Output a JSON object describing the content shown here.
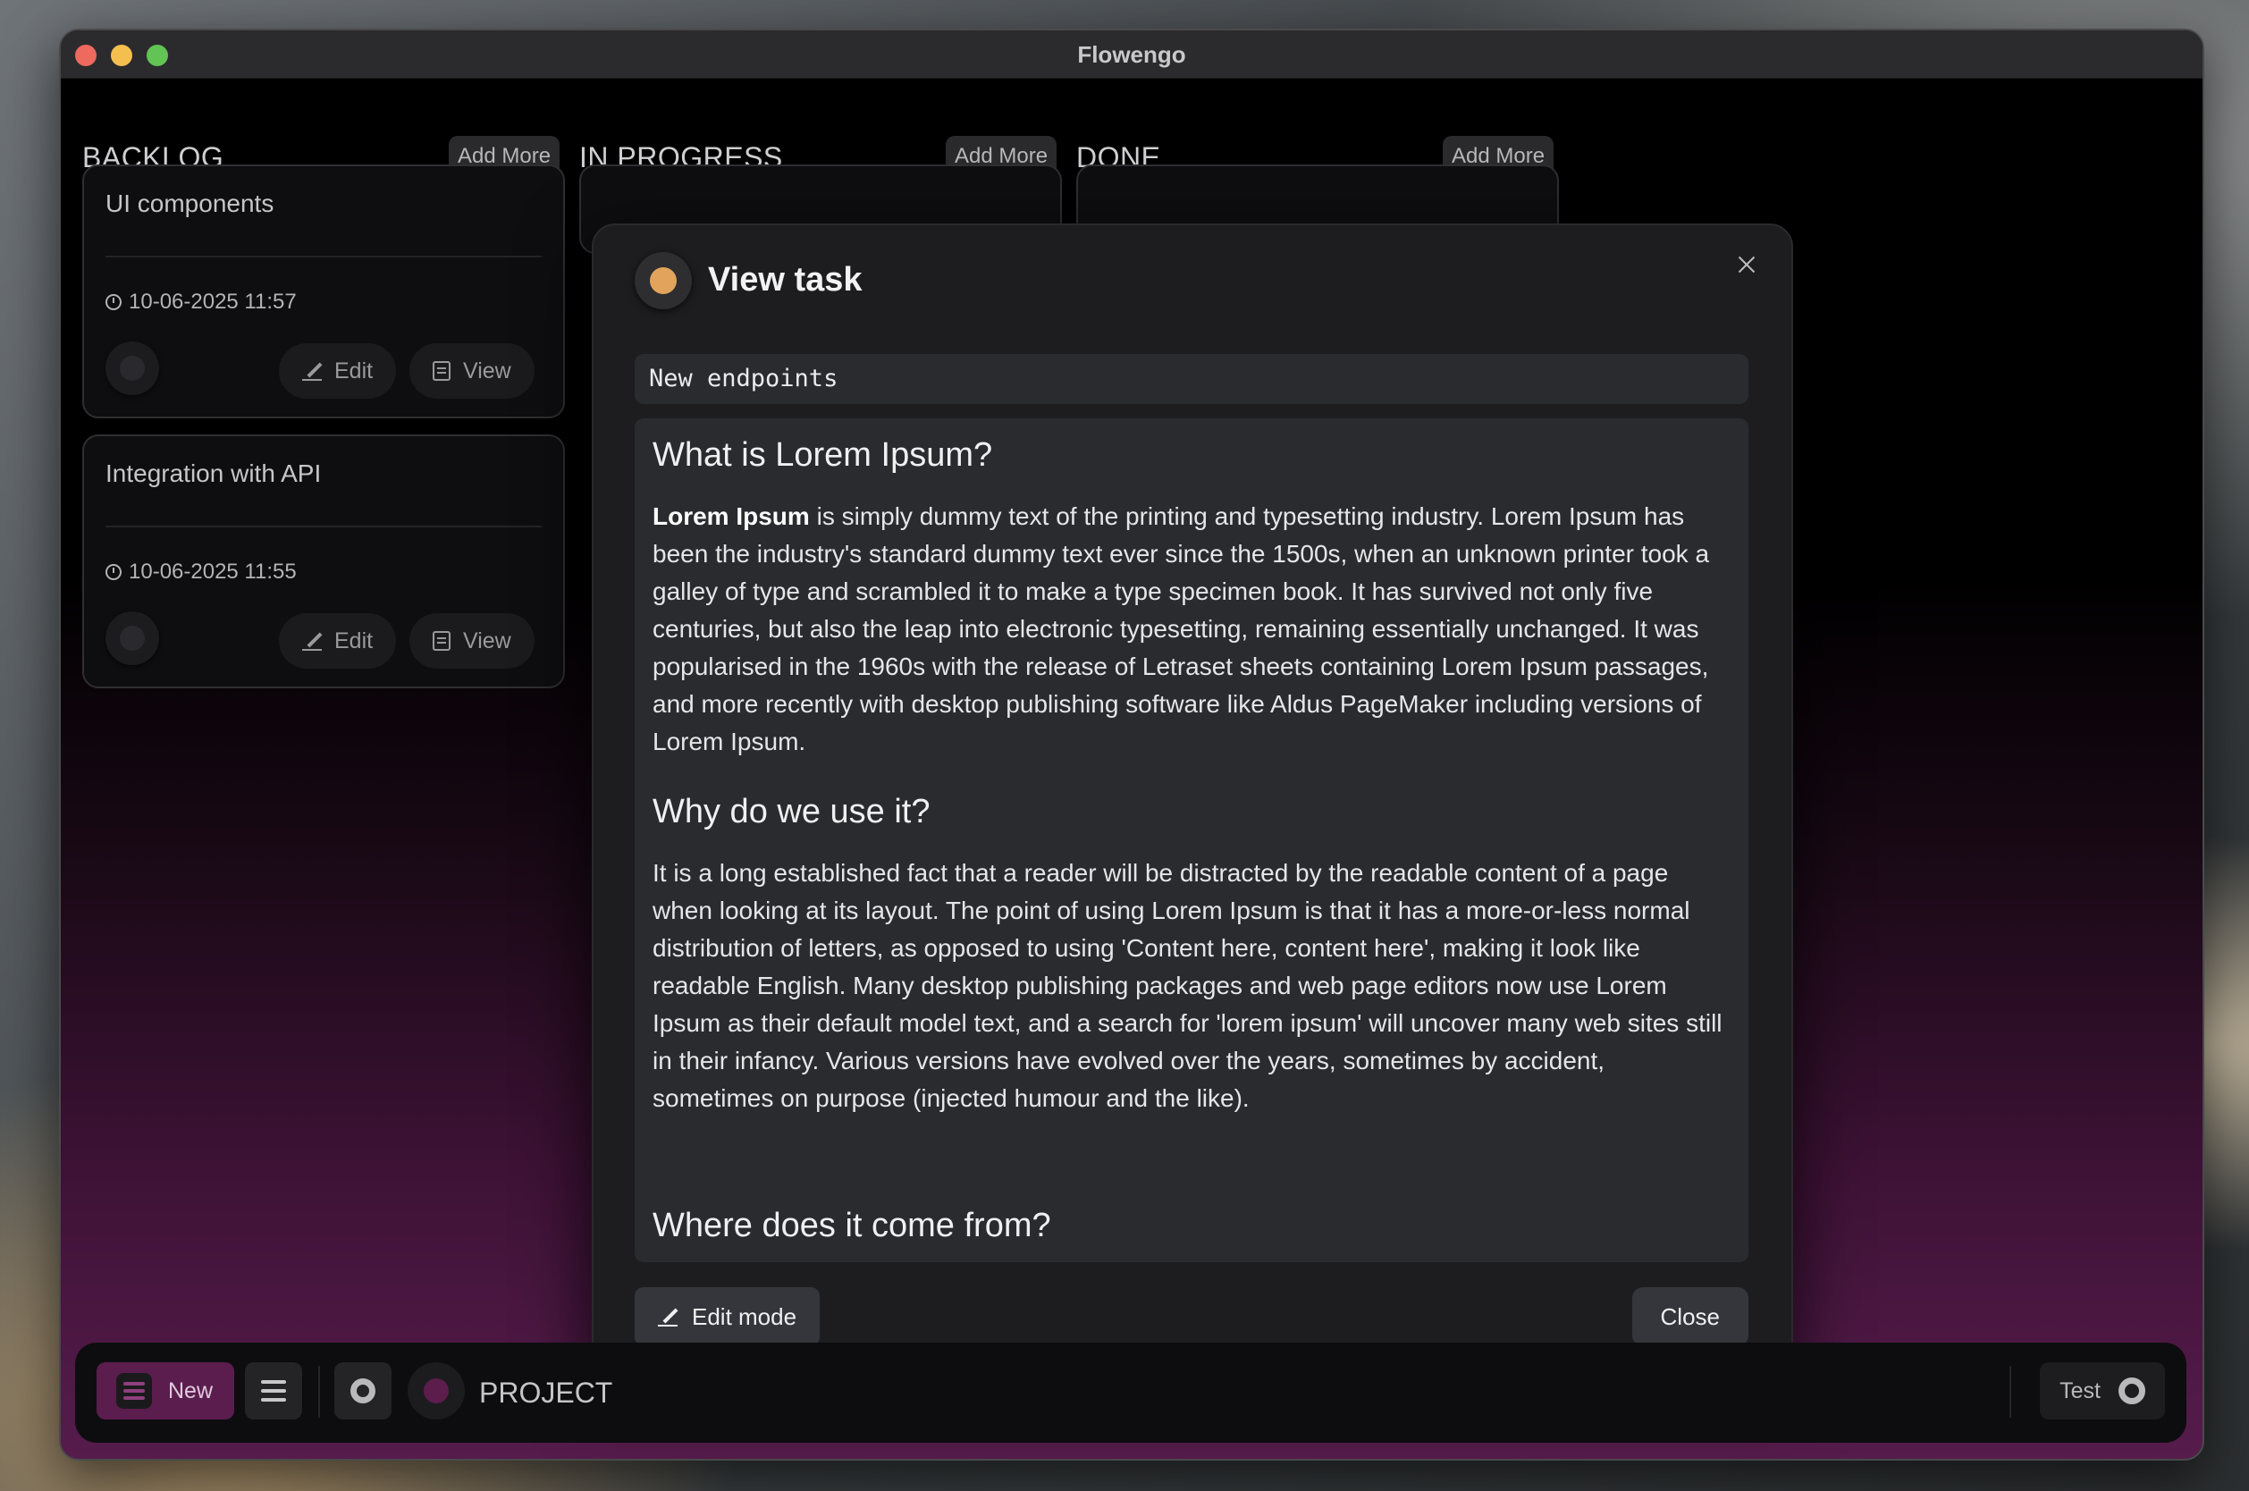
{
  "window": {
    "title": "Flowengo"
  },
  "columns": [
    {
      "title": "BACKLOG",
      "add_label": "Add More"
    },
    {
      "title": "IN PROGRESS",
      "add_label": "Add More"
    },
    {
      "title": "DONE",
      "add_label": "Add More"
    }
  ],
  "cards": [
    {
      "title": "UI components",
      "date": "10-06-2025 11:57",
      "edit_label": "Edit",
      "view_label": "View"
    },
    {
      "title": "Integration with API",
      "date": "10-06-2025 11:55",
      "edit_label": "Edit",
      "view_label": "View"
    }
  ],
  "modal": {
    "title": "View task",
    "task_name": "New endpoints",
    "content": {
      "heading1": "What is Lorem Ipsum?",
      "p1_bold": "Lorem Ipsum",
      "p1_rest": " is simply dummy text of the printing and typesetting industry. Lorem Ipsum has been the industry's standard dummy text ever since the 1500s, when an unknown printer took a galley of type and scrambled it to make a type specimen book. It has survived not only five centuries, but also the leap into electronic typesetting, remaining essentially unchanged. It was popularised in the 1960s with the release of Letraset sheets containing Lorem Ipsum passages, and more recently with desktop publishing software like Aldus PageMaker including versions of Lorem Ipsum.",
      "heading2": "Why do we use it?",
      "p2": "It is a long established fact that a reader will be distracted by the readable content of a page when looking at its layout. The point of using Lorem Ipsum is that it has a more-or-less normal distribution of letters, as opposed to using 'Content here, content here', making it look like readable English. Many desktop publishing packages and web page editors now use Lorem Ipsum as their default model text, and a search for 'lorem ipsum' will uncover many web sites still in their infancy. Various versions have evolved over the years, sometimes by accident, sometimes on purpose (injected humour and the like).",
      "heading3": "Where does it come from?"
    },
    "edit_mode_label": "Edit mode",
    "close_label": "Close",
    "accent_color": "#e2a45c"
  },
  "toolbar": {
    "new_label": "New",
    "project_label": "PROJECT",
    "user_label": "Test",
    "accent_color": "#5a1d4e"
  }
}
